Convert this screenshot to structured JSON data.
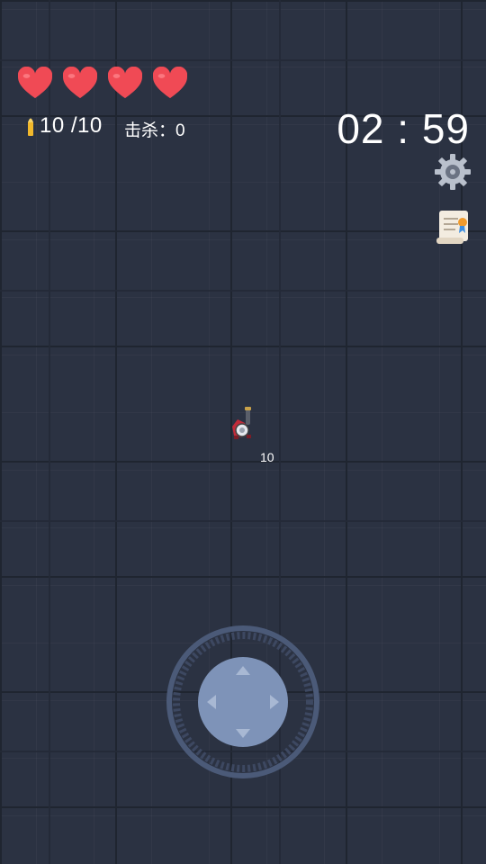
{
  "hud": {
    "hearts": 4,
    "ammo": "10 /10",
    "kills": "击杀：0",
    "timer": "02 : 59"
  },
  "player": {
    "ammo_label": "10"
  },
  "colors": {
    "heart": "#f04a55",
    "bullet": "#f1b82c",
    "joystick": "#7e93b8"
  },
  "icons": [
    "heart-icon",
    "bullet-icon",
    "gear-icon",
    "scroll-icon",
    "player-character",
    "joystick"
  ]
}
